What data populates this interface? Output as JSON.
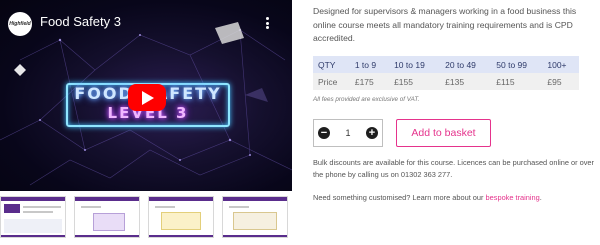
{
  "video": {
    "channel_logo": "Highfield",
    "title": "Food Safety 3",
    "overlay_line1": "FOOD SAFETY",
    "overlay_line2": "LEVEL 3",
    "icons": [
      "play-icon",
      "more-vertical-icon"
    ]
  },
  "thumbnails": [
    {
      "name": "thumbnail-1"
    },
    {
      "name": "thumbnail-2"
    },
    {
      "name": "thumbnail-3"
    },
    {
      "name": "thumbnail-4"
    }
  ],
  "description": "Designed for supervisors & managers working in a food business this online course meets all mandatory training requirements and is CPD accredited.",
  "pricing": {
    "qty_header": "QTY",
    "price_header": "Price",
    "tiers": [
      {
        "qty": "1 to 9",
        "price": "£175"
      },
      {
        "qty": "10 to 19",
        "price": "£155"
      },
      {
        "qty": "20 to 49",
        "price": "£135"
      },
      {
        "qty": "50 to 99",
        "price": "£115"
      },
      {
        "qty": "100+",
        "price": "£95"
      }
    ],
    "vat_note": "All fees provided are exclusive of VAT."
  },
  "quantity": {
    "value": "1",
    "minus_icon": "minus-icon",
    "plus_icon": "plus-icon"
  },
  "basket_button": "Add to basket",
  "bulk_text": "Bulk discounts are available for this course. Licences can be purchased online or over the phone by calling us on 01302 363 277.",
  "custom": {
    "text": "Need something customised? Learn more about our ",
    "link": "bespoke training",
    "suffix": "."
  },
  "colors": {
    "accent": "#e5338c",
    "table_header_bg": "#dfe5f6",
    "play_button": "#ff0000"
  }
}
